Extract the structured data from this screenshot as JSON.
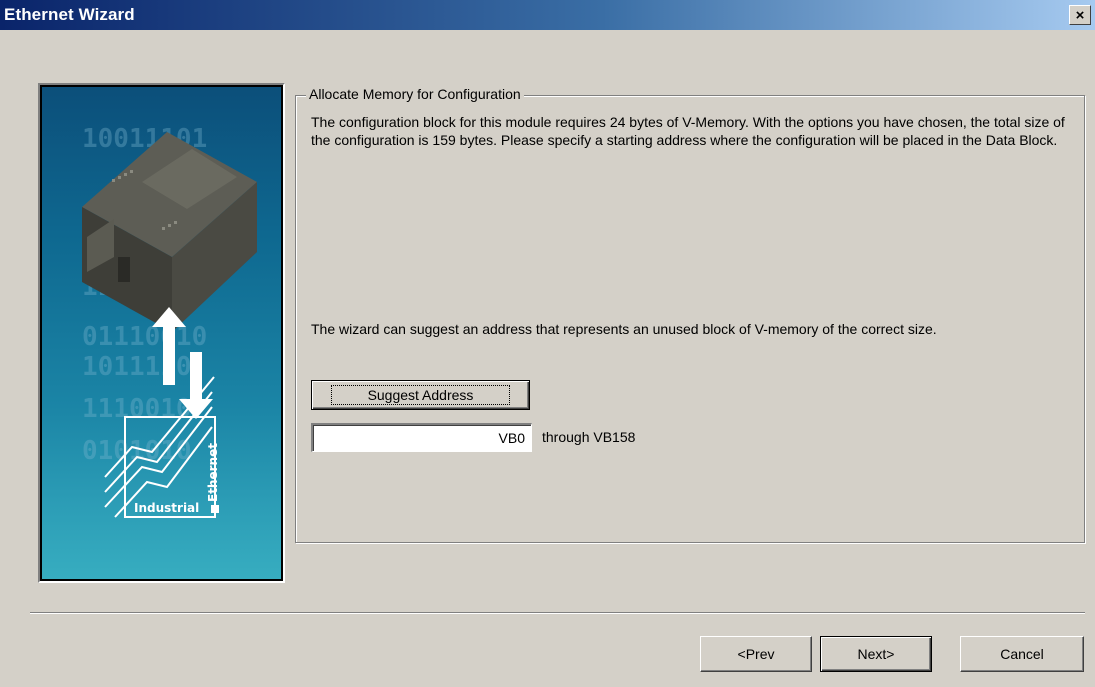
{
  "window": {
    "title": "Ethernet Wizard",
    "close_label": "×"
  },
  "image_panel": {
    "brand_text": "Industrial",
    "brand_vertical": "Ethernet",
    "background_digits": [
      "10011101",
      "1110110",
      "01110010",
      "1011110",
      "1110010",
      "0101010"
    ]
  },
  "group": {
    "legend": "Allocate Memory for Configuration",
    "description": "The configuration block for this module requires 24 bytes of V-Memory. With the options you have chosen, the total size of the configuration is 159 bytes. Please specify a starting address where the configuration will be placed in the Data Block.",
    "suggest_info": "The wizard can suggest an address that represents an unused block of V-memory of the correct size.",
    "suggest_button": "Suggest Address",
    "address_value": "VB0",
    "through_label": "through VB158"
  },
  "footer": {
    "prev": "<Prev",
    "next": "Next>",
    "cancel": "Cancel"
  },
  "colors": {
    "titlebar_start": "#0a246a",
    "titlebar_end": "#a6caf0",
    "dialog_bg": "#d4d0c8"
  }
}
